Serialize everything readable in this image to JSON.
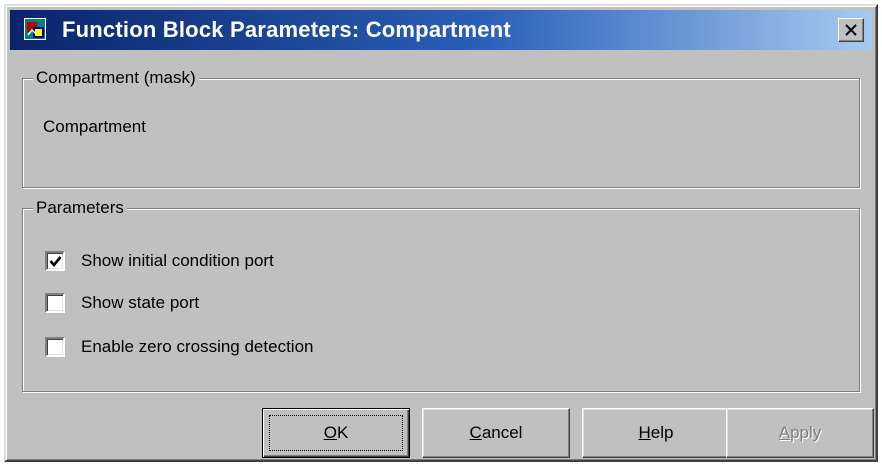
{
  "window": {
    "title": "Function Block Parameters: Compartment",
    "app_icon": "simulink-block-icon",
    "close_icon": "close-x-icon"
  },
  "mask_group": {
    "legend": "Compartment (mask)",
    "description": "Compartment"
  },
  "params_group": {
    "legend": "Parameters",
    "options": [
      {
        "label": "Show initial condition port",
        "checked": true
      },
      {
        "label": "Show state port",
        "checked": false
      },
      {
        "label": "Enable zero crossing detection",
        "checked": false
      }
    ]
  },
  "buttons": {
    "ok": {
      "mnemonic": "O",
      "rest": "K",
      "enabled": true,
      "default": true
    },
    "cancel": {
      "mnemonic": "C",
      "rest": "ancel",
      "enabled": true
    },
    "help": {
      "mnemonic": "H",
      "rest": "elp",
      "enabled": true
    },
    "apply": {
      "mnemonic": "A",
      "rest": "pply",
      "enabled": false
    }
  },
  "colors": {
    "titlebar_start": "#0a246a",
    "titlebar_end": "#a6caf0",
    "face": "#c0c0c0"
  }
}
